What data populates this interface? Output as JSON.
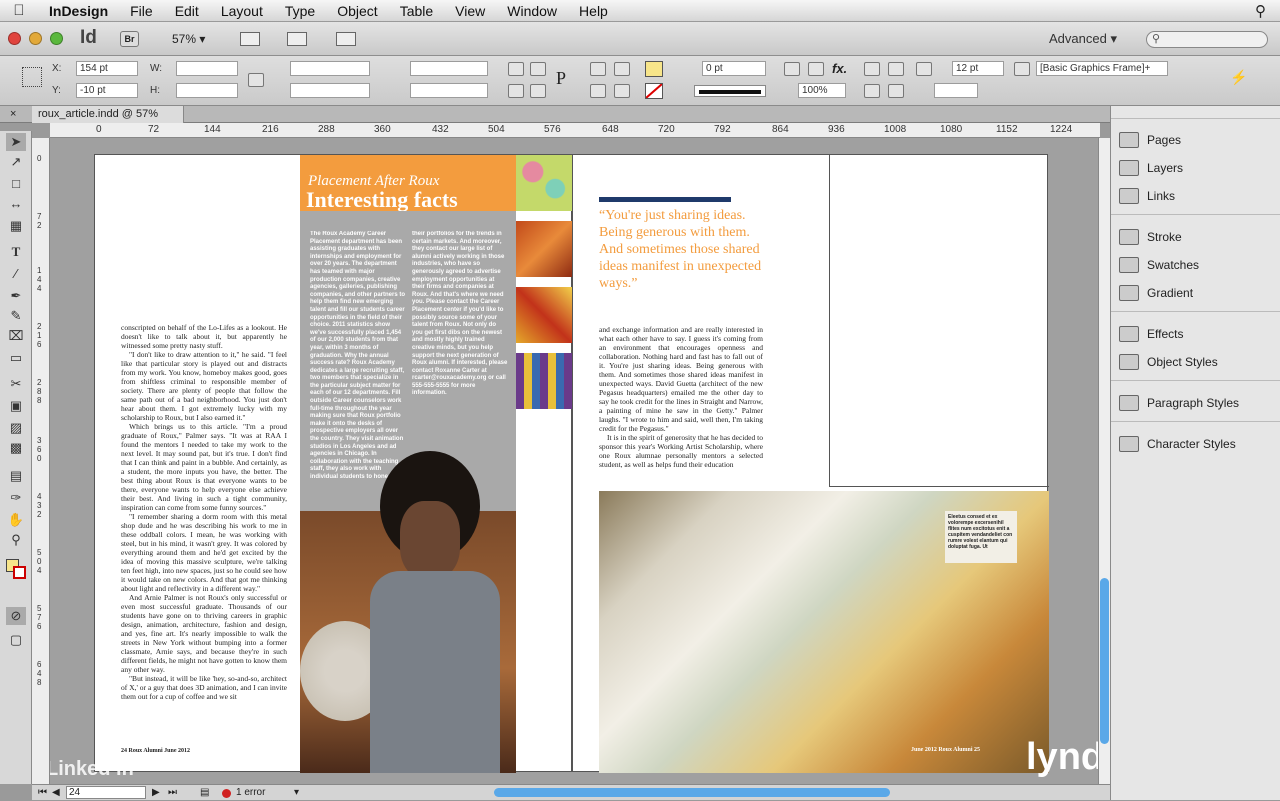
{
  "menubar": {
    "app": "InDesign",
    "items": [
      "File",
      "Edit",
      "Layout",
      "Type",
      "Object",
      "Table",
      "View",
      "Window",
      "Help"
    ]
  },
  "appbar": {
    "logo": "Id",
    "bridge": "Br",
    "zoom": "57%",
    "workspace": "Advanced"
  },
  "control": {
    "x": "154 pt",
    "y": "-10 pt",
    "w_label": "W:",
    "h_label": "H:",
    "x_label": "X:",
    "y_label": "Y:",
    "stroke_weight": "0 pt",
    "opacity": "100%",
    "size": "12 pt",
    "frame_style": "[Basic Graphics Frame]+"
  },
  "tab": {
    "title": "roux_article.indd @ 57%"
  },
  "ruler": {
    "h": [
      "0",
      "72",
      "144",
      "216",
      "288",
      "360",
      "432",
      "504",
      "576",
      "648",
      "720",
      "792",
      "864",
      "936",
      "1008",
      "1080",
      "1152",
      "1224"
    ],
    "v": [
      "0",
      "7 2",
      "1 4 4",
      "2 1 6",
      "2 8 8",
      "3 6 0",
      "4 3 2",
      "5 0 4",
      "5 7 6",
      "6 4 8"
    ]
  },
  "spread": {
    "kicker": "Placement After Roux",
    "headline": "Interesting facts",
    "sidebar_col1": "The Roux Academy Career Placement department has been assisting graduates with internships and employment for over 20 years. The department has teamed with major production companies, creative agencies, galleries, publishing companies, and other partners to help them find new emerging talent and fill our students career opportunities in the field of their choice. 2011 statistics show we've successfully placed 1,454 of our 2,000 students from that year, within 3 months of graduation. Why the annual success rate? Roux Academy dedicates a large recruiting staff, two members that specialize in the particular subject matter for each of our 12 departments. Fill outside Career counselors work full-time throughout the year making sure that Roux portfolio make it onto the desks of prospective employers all over the country. They visit animation studios in Los Angeles and ad agencies in Chicago. In collaboration with the teaching staff, they also work with individual students to hone",
    "sidebar_col2": "their portfolios for the trends in certain markets. And moreover, they contact our large list of alumni actively working in those industries, who have so generously agreed to advertise employment opportunities at their firms and companies at Roux. And that's where we need you. Please contact the Career Placement center if you'd like to possibly source some of your talent from Roux. Not only do you get first dibs on the newest and mostly highly trained creative minds, but you help support the next generation of Roux alumni. If interested, please contact Roxanne Carter at rcarter@rouxacademy.org or call 555-555-5555 for more information.",
    "left_body_1": "conscripted on behalf of the Lo-Lifes as a lookout. He doesn't like to talk about it, but apparently he witnessed some pretty nasty stuff.",
    "left_body_2": "\"I don't like to draw attention to it,\" he said. \"I feel like that particular story is played out and distracts from my work. You know, homeboy makes good, goes from shiftless criminal to responsible member of society. There are plenty of people that follow the same path out of a bad neighborhood. You just don't hear about them. I got extremely lucky with my scholarship to Roux, but I also earned it.\"",
    "left_body_3": "Which brings us to this article. \"I'm a proud graduate of Roux,\" Palmer says. \"It was at RAA I found the mentors I needed to take my work to the next level. It may sound pat, but it's true. I don't find that I can think and paint in a bubble. And certainly, as a student, the more inputs you have, the better. The best thing about Roux is that everyone wants to be there, everyone wants to help everyone else achieve their best. And living in such a tight community, inspiration can come from some funny sources.\"",
    "left_body_4": "\"I remember sharing a dorm room with this metal shop dude and he was describing his work to me in these oddball colors. I mean, he was working with steel, but in his mind, it wasn't grey. It was colored by everything around them and he'd get excited by the idea of moving this massive sculpture, we're talking ten feet high, into new spaces, just so he could see how it would take on new colors. And that got me thinking about light and reflectivity in a different way.\"",
    "left_body_5": "And Arnie Palmer is not Roux's only successful or even most successful graduate. Thousands of our students have gone on to thriving careers in graphic design, animation, architecture, fashion and design, and yes, fine art. It's nearly impossible to walk the streets in New York without bumping into a former classmate, Arnie says, and because they're in such different fields, he might not have gotten to know them any other way.",
    "left_body_6": "\"But instead, it will be like 'hey, so-and-so, architect of X,' or a guy that does 3D animation, and I can invite them out for a cup of coffee and we sit",
    "pullquote": "“You're just sharing ideas. Being generous with them. And sometimes those shared ideas manifest in unexpected ways.”",
    "right_body_1": "and exchange information and are really interested in what each other have to say. I guess it's coming from an environment that encourages openness and collaboration. Nothing hard and fast has to fall out of it. You're just sharing ideas. Being generous with them. And sometimes those shared ideas manifest in unexpected ways. David Guetta (architect of the new Pegasus headquarters) emailed me the other day to say he took credit for the lines in Straight and Narrow, a painting of mine he saw in the Getty.\" Palmer laughs. \"I wrote to him and said, well then, I'm taking credit for the Pegasus.\"",
    "right_body_2": "It is in the spirit of generosity that he has decided to sponsor this year's Working Artist Scholarship, where one Roux alumnae personally mentors a selected student, as well as helps fund their education",
    "caption": "Eleetus consed et ex volorempe excersenihil flites num excitotus enit a cuspitem vendandeliet con rumre volest elantum qui doluptat fuga. Ut",
    "folio_left": "24  Roux Alumni  June 2012",
    "folio_right": "June 2012  Roux Alumni  25"
  },
  "panel": {
    "items": [
      {
        "label": "Pages",
        "icon": "pages-icon"
      },
      {
        "label": "Layers",
        "icon": "layers-icon"
      },
      {
        "label": "Links",
        "icon": "links-icon"
      },
      {
        "label": "Stroke",
        "icon": "stroke-icon"
      },
      {
        "label": "Swatches",
        "icon": "swatches-icon"
      },
      {
        "label": "Gradient",
        "icon": "gradient-icon"
      },
      {
        "label": "Effects",
        "icon": "fx-icon"
      },
      {
        "label": "Object Styles",
        "icon": "object-styles-icon"
      },
      {
        "label": "Paragraph Styles",
        "icon": "paragraph-styles-icon"
      },
      {
        "label": "Character Styles",
        "icon": "character-styles-icon"
      }
    ]
  },
  "status": {
    "page": "24",
    "errors": "1 error"
  },
  "watermark": {
    "left": "Linked in",
    "right": "lynda.com"
  },
  "colors": {
    "orange": "#f39c3e",
    "gray_sidebar": "#a9a9a9",
    "navy": "#1f3a6b"
  }
}
